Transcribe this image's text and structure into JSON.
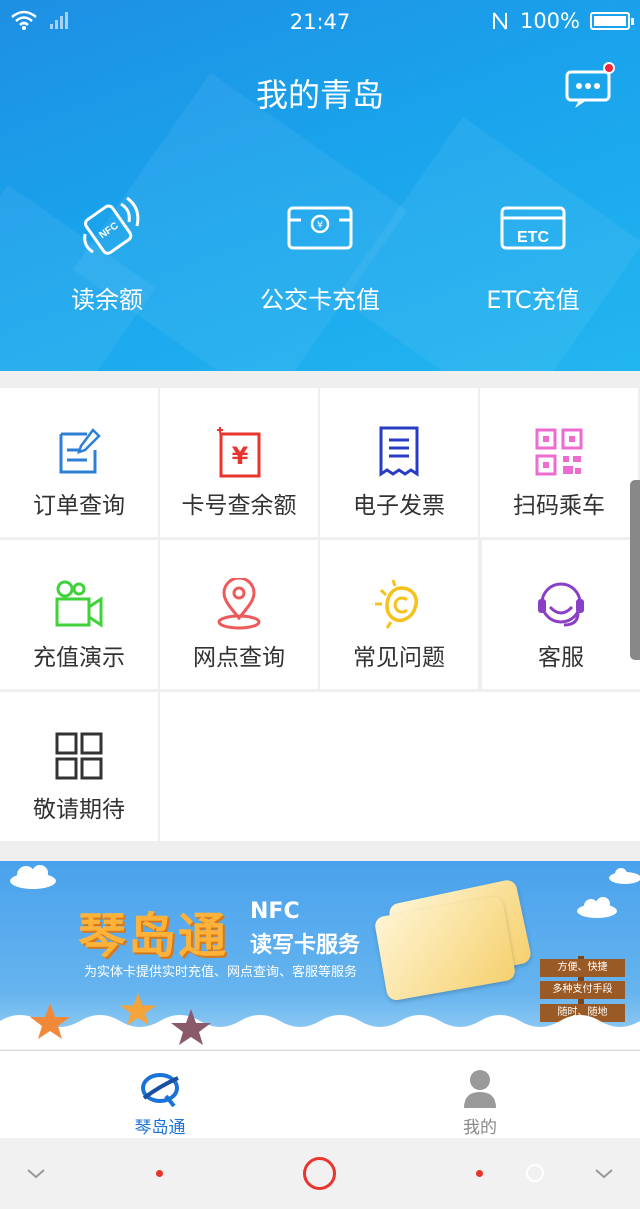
{
  "status_bar": {
    "time": "21:47",
    "battery": "100%"
  },
  "header": {
    "title": "我的青岛",
    "top_actions": [
      {
        "label": "读余额",
        "icon": "nfc-phone-icon"
      },
      {
        "label": "公交卡充值",
        "icon": "card-yuan-icon"
      },
      {
        "label": "ETC充值",
        "icon": "etc-card-icon"
      }
    ]
  },
  "services": [
    {
      "label": "订单查询",
      "icon": "order-icon",
      "color": "#2d7fd6"
    },
    {
      "label": "卡号查余额",
      "icon": "card-balance-icon",
      "color": "#e8352e"
    },
    {
      "label": "电子发票",
      "icon": "invoice-icon",
      "color": "#2a3cc4"
    },
    {
      "label": "扫码乘车",
      "icon": "qr-code-icon",
      "color": "#ee6bd0"
    },
    {
      "label": "充值演示",
      "icon": "video-camera-icon",
      "color": "#3fd23a"
    },
    {
      "label": "网点查询",
      "icon": "location-pin-icon",
      "color": "#ee5a5a"
    },
    {
      "label": "常见问题",
      "icon": "lightbulb-icon",
      "color": "#f5c21b"
    },
    {
      "label": "客服",
      "icon": "headset-icon",
      "color": "#8a3fc7"
    },
    {
      "label": "敬请期待",
      "icon": "grid-icon",
      "color": "#333333"
    }
  ],
  "banner": {
    "brand": "琴岛通",
    "nfc_line1": "NFC",
    "nfc_line2": "读写卡服务",
    "subtitle": "为实体卡提供实时充值、网点查询、客服等服务",
    "signs": [
      "方便、快捷",
      "多种支付手段",
      "随时、随地"
    ]
  },
  "tabbar": [
    {
      "label": "琴岛通",
      "active": true,
      "color": "#1a73d6"
    },
    {
      "label": "我的",
      "active": false,
      "color": "#888888"
    }
  ]
}
